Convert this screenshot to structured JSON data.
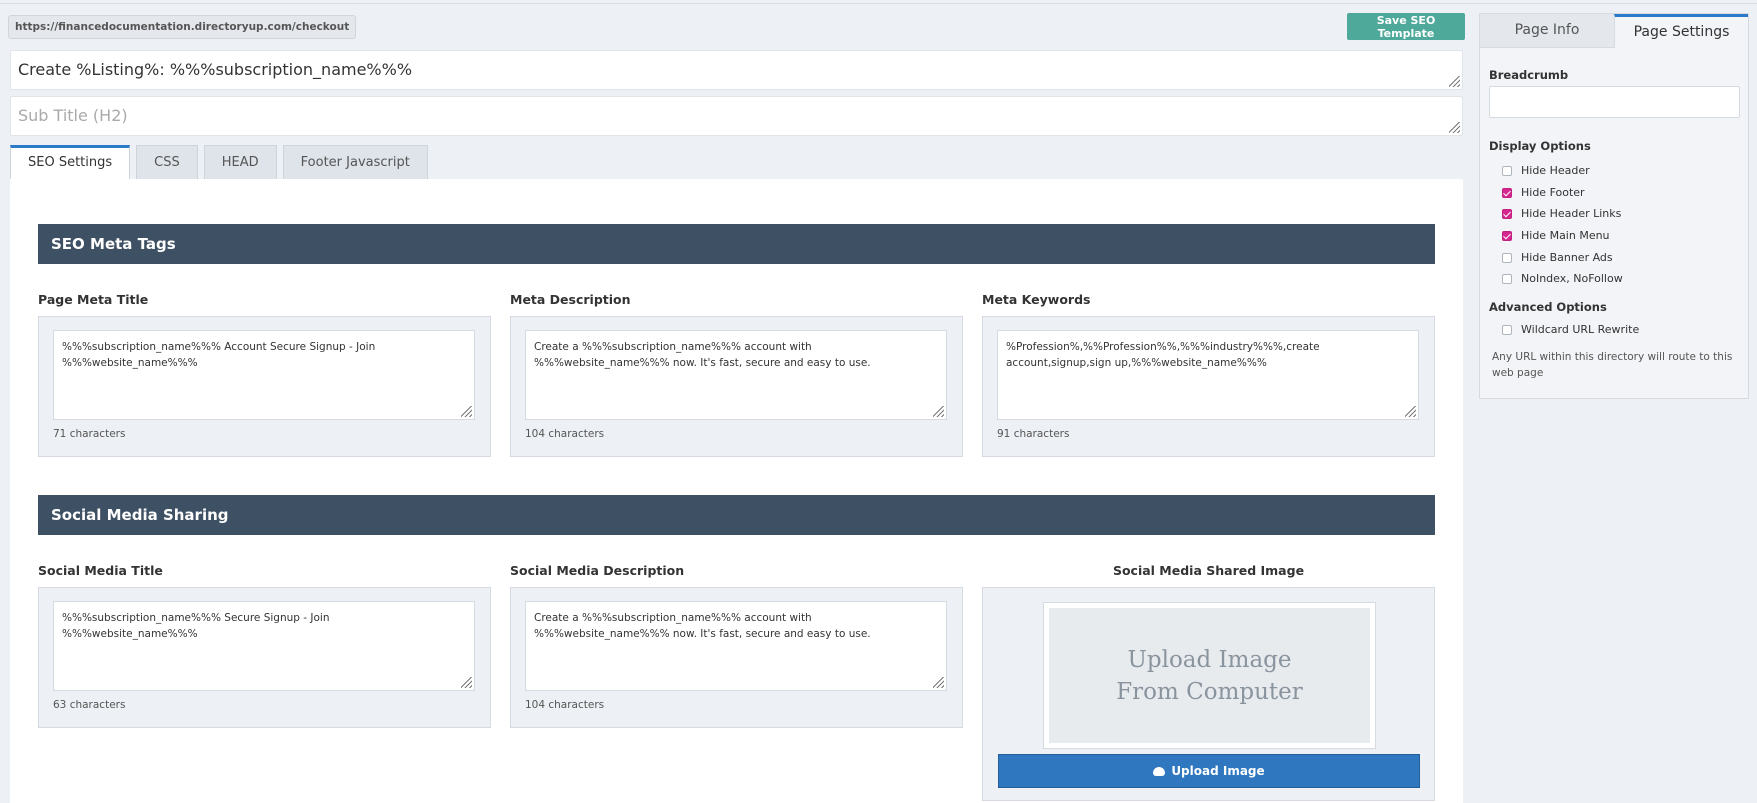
{
  "url": "https://financedocumentation.directoryup.com/checkout",
  "save_button": "Save SEO Template",
  "page_title": "Create %Listing%: %%%subscription_name%%%",
  "subtitle_placeholder": "Sub Title (H2)",
  "tabs": [
    {
      "label": "SEO Settings",
      "active": true
    },
    {
      "label": "CSS",
      "active": false
    },
    {
      "label": "HEAD",
      "active": false
    },
    {
      "label": "Footer Javascript",
      "active": false
    }
  ],
  "seo_meta": {
    "header": "SEO Meta Tags",
    "fields": [
      {
        "label": "Page Meta Title",
        "value": "%%%subscription_name%%% Account Secure Signup - Join %%%website_name%%%",
        "count": "71 characters"
      },
      {
        "label": "Meta Description",
        "value": "Create a %%%subscription_name%%% account with %%%website_name%%% now. It's fast, secure and easy to use.",
        "count": "104 characters"
      },
      {
        "label": "Meta Keywords",
        "value": "%Profession%,%%Profession%%,%%%industry%%%,create account,signup,sign up,%%%website_name%%%",
        "count": "91 characters"
      }
    ]
  },
  "social": {
    "header": "Social Media Sharing",
    "fields": [
      {
        "label": "Social Media Title",
        "value": "%%%subscription_name%%% Secure Signup - Join %%%website_name%%%",
        "count": "63 characters"
      },
      {
        "label": "Social Media Description",
        "value": "Create a %%%subscription_name%%% account with %%%website_name%%% now. It's fast, secure and easy to use.",
        "count": "104 characters"
      }
    ],
    "image_label": "Social Media Shared Image",
    "image_placeholder_line1": "Upload Image",
    "image_placeholder_line2": "From Computer",
    "upload_button": "Upload Image"
  },
  "sidebar": {
    "tabs": [
      {
        "label": "Page Info",
        "active": false
      },
      {
        "label": "Page Settings",
        "active": true
      }
    ],
    "breadcrumb_label": "Breadcrumb",
    "breadcrumb_value": "",
    "display_options_label": "Display Options",
    "display_options": [
      {
        "label": "Hide Header",
        "checked": false
      },
      {
        "label": "Hide Footer",
        "checked": true
      },
      {
        "label": "Hide Header Links",
        "checked": true
      },
      {
        "label": "Hide Main Menu",
        "checked": true
      },
      {
        "label": "Hide Banner Ads",
        "checked": false
      },
      {
        "label": "NoIndex, NoFollow",
        "checked": false
      }
    ],
    "advanced_options_label": "Advanced Options",
    "advanced_options": [
      {
        "label": "Wildcard URL Rewrite",
        "checked": false
      }
    ],
    "note": "Any URL within this directory will route to this web page"
  },
  "colors": {
    "accent_blue": "#2f77bf",
    "save_green": "#4fa99a",
    "section_header": "#3e5063",
    "checkbox_checked": "#d6268f"
  }
}
